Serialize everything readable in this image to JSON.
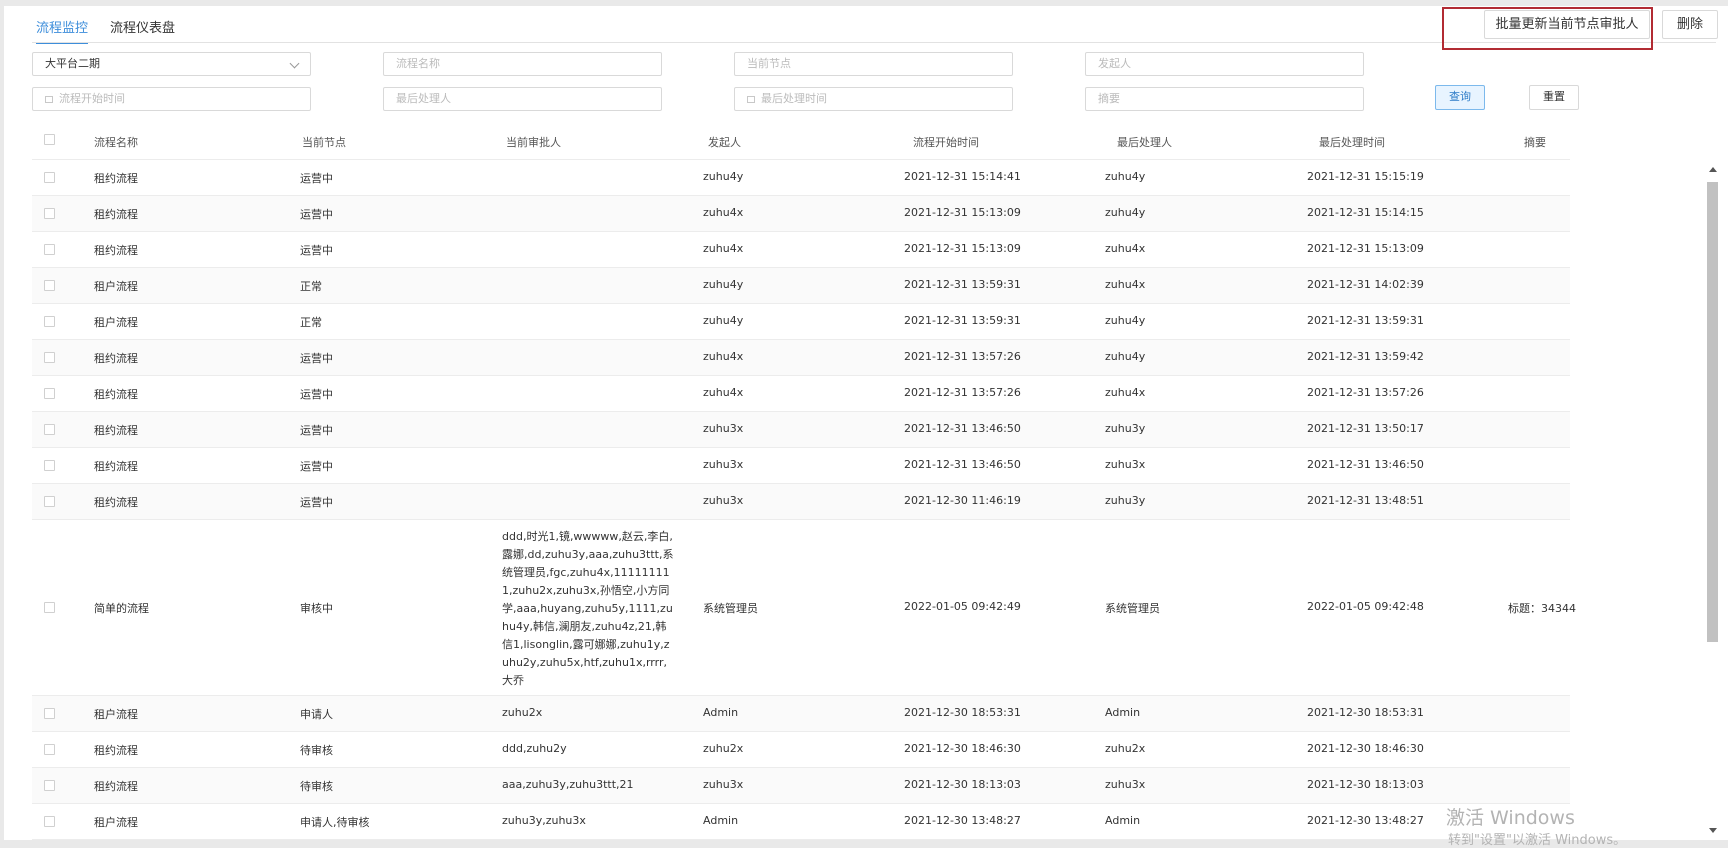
{
  "tabs": [
    "流程监控",
    "流程仪表盘"
  ],
  "toolbar": {
    "batch_update": "批量更新当前节点审批人",
    "delete": "删除"
  },
  "filters": {
    "platform": "大平台二期",
    "process_name": "流程名称",
    "current_node": "当前节点",
    "initiator": "发起人",
    "start_time": "流程开始时间",
    "last_handler": "最后处理人",
    "last_time": "最后处理时间",
    "summary": "摘要",
    "query": "查询",
    "reset": "重置"
  },
  "table": {
    "columns": [
      "流程名称",
      "当前节点",
      "当前审批人",
      "发起人",
      "流程开始时间",
      "最后处理人",
      "最后处理时间",
      "摘要"
    ],
    "rows": [
      [
        "租约流程",
        "运营中",
        "",
        "zuhu4y",
        "2021-12-31 15:14:41",
        "zuhu4y",
        "2021-12-31 15:15:19",
        ""
      ],
      [
        "租约流程",
        "运营中",
        "",
        "zuhu4x",
        "2021-12-31 15:13:09",
        "zuhu4y",
        "2021-12-31 15:14:15",
        ""
      ],
      [
        "租约流程",
        "运营中",
        "",
        "zuhu4x",
        "2021-12-31 15:13:09",
        "zuhu4x",
        "2021-12-31 15:13:09",
        ""
      ],
      [
        "租户流程",
        "正常",
        "",
        "zuhu4y",
        "2021-12-31 13:59:31",
        "zuhu4x",
        "2021-12-31 14:02:39",
        ""
      ],
      [
        "租户流程",
        "正常",
        "",
        "zuhu4y",
        "2021-12-31 13:59:31",
        "zuhu4y",
        "2021-12-31 13:59:31",
        ""
      ],
      [
        "租约流程",
        "运营中",
        "",
        "zuhu4x",
        "2021-12-31 13:57:26",
        "zuhu4y",
        "2021-12-31 13:59:42",
        ""
      ],
      [
        "租约流程",
        "运营中",
        "",
        "zuhu4x",
        "2021-12-31 13:57:26",
        "zuhu4x",
        "2021-12-31 13:57:26",
        ""
      ],
      [
        "租约流程",
        "运营中",
        "",
        "zuhu3x",
        "2021-12-31 13:46:50",
        "zuhu3y",
        "2021-12-31 13:50:17",
        ""
      ],
      [
        "租约流程",
        "运营中",
        "",
        "zuhu3x",
        "2021-12-31 13:46:50",
        "zuhu3x",
        "2021-12-31 13:46:50",
        ""
      ],
      [
        "租约流程",
        "运营中",
        "",
        "zuhu3x",
        "2021-12-30 11:46:19",
        "zuhu3y",
        "2021-12-31 13:48:51",
        ""
      ],
      [
        "简单的流程",
        "审核中",
        "ddd,时光1,镜,wwwww,赵云,李白,露娜,dd,zuhu3y,aaa,zuhu3ttt,系统管理员,fgc,zuhu4x,111111111,zuhu2x,zuhu3x,孙悟空,小方同学,aaa,huyang,zuhu5y,1111,zuhu4y,韩信,澜朋友,zuhu4z,21,韩信1,lisonglin,露可娜娜,zuhu1y,zuhu2y,zuhu5x,htf,zuhu1x,rrrr,大乔",
        "系统管理员",
        "2022-01-05 09:42:49",
        "系统管理员",
        "2022-01-05 09:42:48",
        "标题：34344"
      ],
      [
        "租户流程",
        "申请人",
        "zuhu2x",
        "Admin",
        "2021-12-30 18:53:31",
        "Admin",
        "2021-12-30 18:53:31",
        ""
      ],
      [
        "租约流程",
        "待审核",
        "ddd,zuhu2y",
        "zuhu2x",
        "2021-12-30 18:46:30",
        "zuhu2x",
        "2021-12-30 18:46:30",
        ""
      ],
      [
        "租约流程",
        "待审核",
        "aaa,zuhu3y,zuhu3ttt,21",
        "zuhu3x",
        "2021-12-30 18:13:03",
        "zuhu3x",
        "2021-12-30 18:13:03",
        ""
      ],
      [
        "租户流程",
        "申请人,待审核",
        "zuhu3y,zuhu3x",
        "Admin",
        "2021-12-30 13:48:27",
        "Admin",
        "2021-12-30 13:48:27",
        ""
      ]
    ]
  },
  "watermark": {
    "line1": "激活 Windows",
    "line2": "转到\"设置\"以激活 Windows。"
  }
}
